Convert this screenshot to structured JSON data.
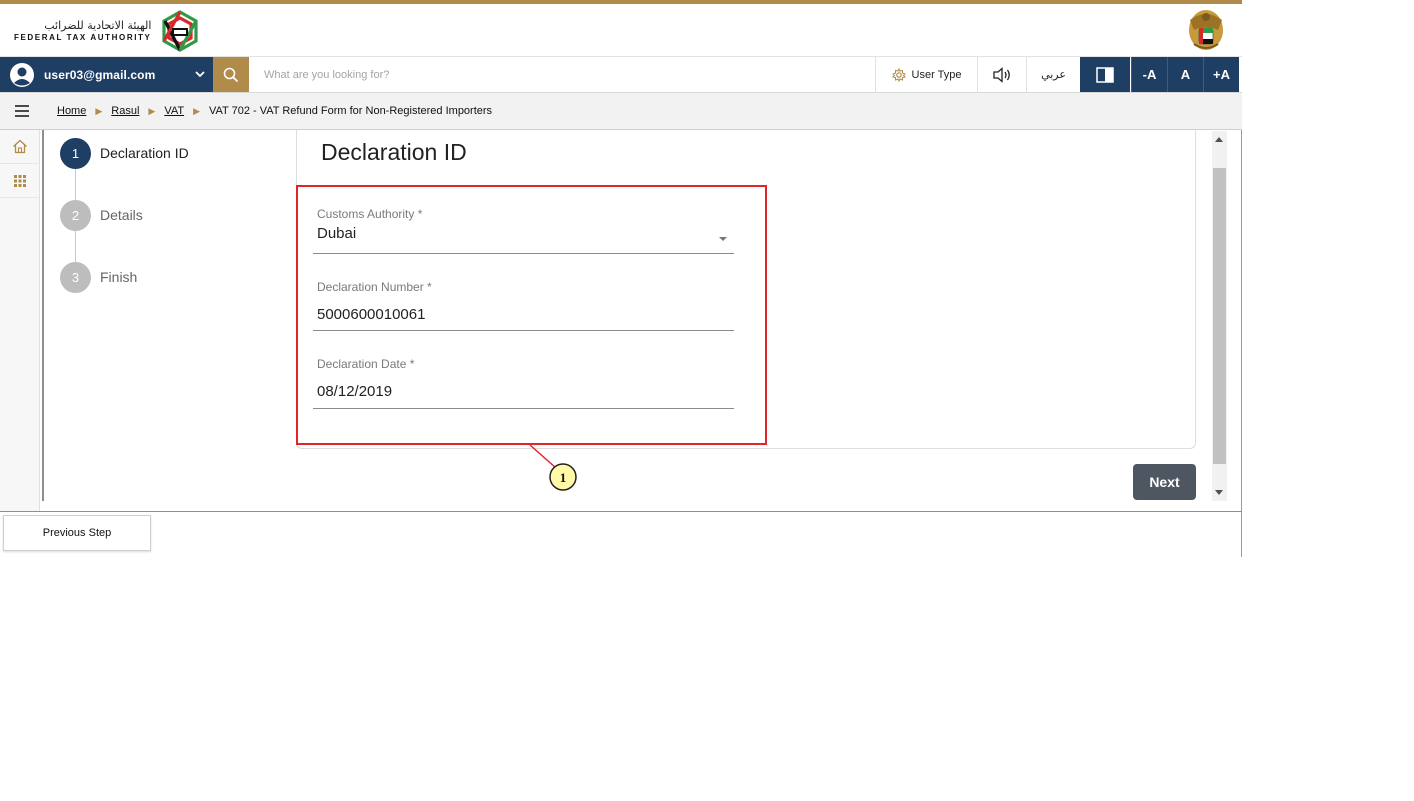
{
  "header": {
    "logo_ar": "الهيئة الاتحادية للضرائب",
    "logo_en": "FEDERAL TAX AUTHORITY",
    "logo_icon": "fta-logo",
    "emblem_icon": "uae-emblem"
  },
  "toolbar": {
    "user_email": "user03@gmail.com",
    "search_placeholder": "What are you looking for?",
    "user_type_label": "User Type",
    "arabic_label": "عربي",
    "font_decrease_label": "-A",
    "font_normal_label": "A",
    "font_increase_label": "+A",
    "colors": {
      "navy": "#1f3e63",
      "gold": "#b08b49"
    }
  },
  "breadcrumb": {
    "items": [
      {
        "label": "Home"
      },
      {
        "label": "Rasul"
      },
      {
        "label": "VAT"
      }
    ],
    "current": "VAT 702 - VAT Refund Form for Non-Registered Importers"
  },
  "stepper": {
    "steps": [
      {
        "number": "1",
        "label": "Declaration ID",
        "active": true
      },
      {
        "number": "2",
        "label": "Details",
        "active": false
      },
      {
        "number": "3",
        "label": "Finish",
        "active": false
      }
    ]
  },
  "form": {
    "title": "Declaration ID",
    "customs_authority": {
      "label": "Customs Authority *",
      "value": "Dubai"
    },
    "declaration_number": {
      "label": "Declaration Number *",
      "value": "5000600010061"
    },
    "declaration_date": {
      "label": "Declaration Date *",
      "value": "08/12/2019"
    }
  },
  "annotation": {
    "number": "1",
    "box_color": "#e0262b",
    "marker_color": "#fff9a8"
  },
  "actions": {
    "next_label": "Next",
    "previous_label": "Previous Step"
  }
}
